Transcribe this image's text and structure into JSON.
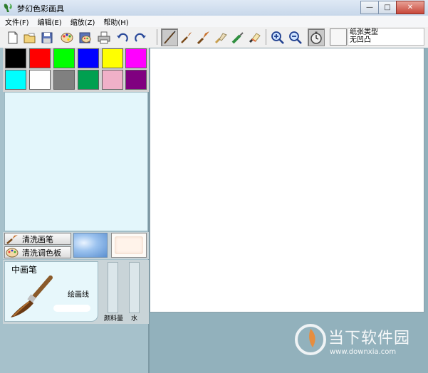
{
  "window": {
    "title": "梦幻色彩画具",
    "controls": {
      "minimize": "—",
      "maximize": "□",
      "close": "✕"
    }
  },
  "menu": [
    "文件(F)",
    "编辑(E)",
    "缩放(Z)",
    "帮助(H)"
  ],
  "toolbar": {
    "file_buttons": [
      "new-icon",
      "open-icon",
      "save-icon",
      "palette-icon",
      "save-palette-icon",
      "print-icon",
      "undo-icon",
      "redo-icon"
    ],
    "brush_buttons": [
      "pencil-brush-icon",
      "small-brush-icon",
      "medium-brush-icon",
      "flat-brush-icon",
      "marker-icon",
      "eraser-icon"
    ],
    "zoom_buttons": [
      "zoom-in-icon",
      "zoom-out-icon",
      "timer-icon"
    ],
    "paper_type_label": "纸张类型",
    "paper_type_value": "无凹凸"
  },
  "palette": {
    "colors": [
      "#000000",
      "#ff0000",
      "#00ff00",
      "#0000ff",
      "#ffff00",
      "#ff00ff",
      "#00ffff",
      "#ffffff",
      "#808080",
      "#00a050",
      "#f0b0c8",
      "#800080"
    ]
  },
  "actions": {
    "clean_brush": "清洗画笔",
    "clean_palette": "清洗调色板"
  },
  "brush": {
    "size": "中画笔",
    "type": "绘画线",
    "paint_meter_label": "颜料量",
    "water_meter_label": "水"
  },
  "watermark": {
    "name": "当下软件园",
    "url": "www.downxia.com"
  }
}
